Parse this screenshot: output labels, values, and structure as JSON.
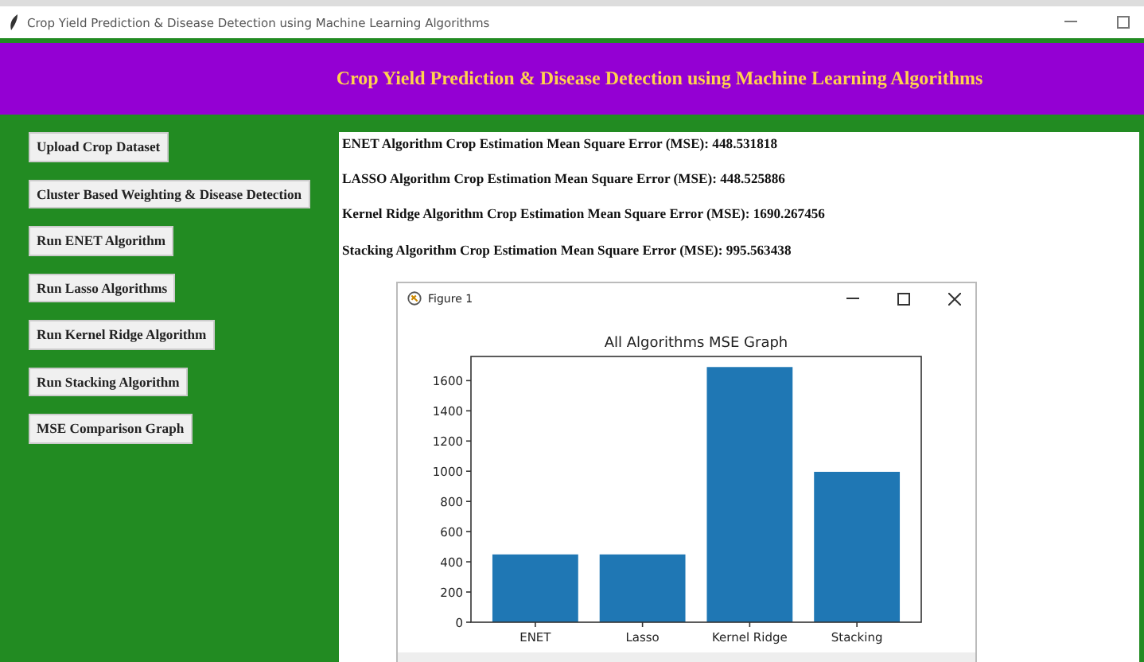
{
  "window": {
    "title": "Crop Yield Prediction & Disease Detection using Machine Learning Algorithms"
  },
  "header": {
    "title": "Crop Yield Prediction & Disease Detection using Machine Learning Algorithms"
  },
  "buttons": [
    "Upload Crop Dataset",
    "Cluster Based Weighting & Disease Detection",
    "Run ENET Algorithm",
    "Run Lasso Algorithms",
    "Run Kernel Ridge Algorithm",
    "Run Stacking Algorithm",
    "MSE Comparison Graph"
  ],
  "output_lines": [
    "ENET Algorithm Crop Estimation Mean Square Error (MSE): 448.531818",
    "LASSO Algorithm Crop Estimation Mean Square Error (MSE): 448.525886",
    "Kernel Ridge Algorithm Crop Estimation Mean Square Error (MSE): 1690.267456",
    "Stacking Algorithm Crop Estimation Mean Square Error (MSE): 995.563438"
  ],
  "figure": {
    "title": "Figure 1",
    "chart_data": {
      "type": "bar",
      "title": "All Algorithms MSE Graph",
      "categories": [
        "ENET",
        "Lasso",
        "Kernel Ridge",
        "Stacking"
      ],
      "series": [
        {
          "color": "#1f77b4",
          "values": [
            449,
            449,
            1690,
            996
          ]
        }
      ],
      "ylim": [
        0,
        1760
      ],
      "yticks": [
        0,
        200,
        400,
        600,
        800,
        1000,
        1200,
        1400,
        1600
      ]
    }
  }
}
